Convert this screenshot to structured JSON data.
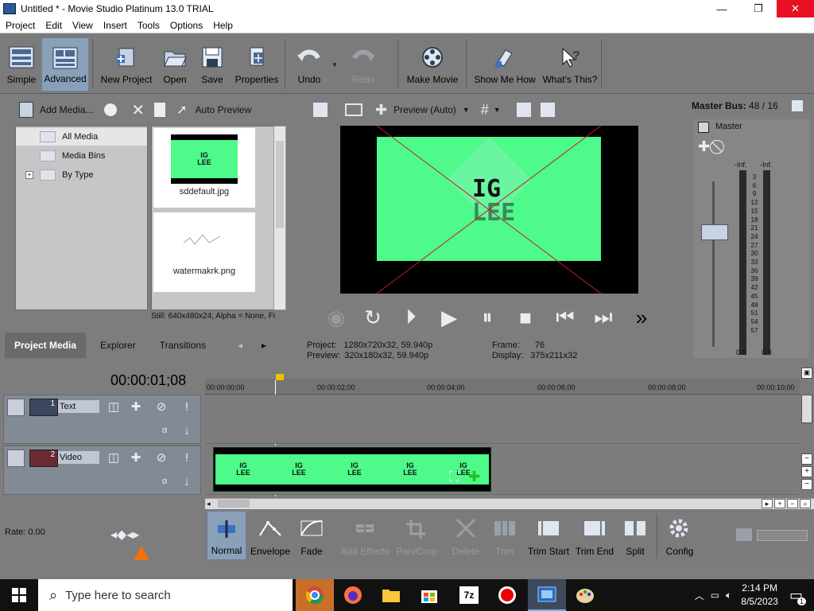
{
  "window": {
    "title": "Untitled * - Movie Studio Platinum 13.0 TRIAL",
    "min": "—",
    "max": "❐",
    "close": "✕"
  },
  "menu": [
    "Project",
    "Edit",
    "View",
    "Insert",
    "Tools",
    "Options",
    "Help"
  ],
  "toolbar": {
    "simple": "Simple",
    "advanced": "Advanced",
    "new_project": "New Project",
    "open": "Open",
    "save": "Save",
    "properties": "Properties",
    "undo": "Undo",
    "redo": "Redo",
    "make_movie": "Make Movie",
    "show_me_how": "Show Me How",
    "whats_this": "What's This?"
  },
  "media": {
    "add_media": "Add Media...",
    "auto_preview": "Auto Preview",
    "tree": [
      "All Media",
      "Media Bins",
      "By Type"
    ],
    "files": [
      "sddefault.jpg",
      "watermakrk.png"
    ],
    "thumb_text": "IG\nLEE",
    "status": "Still: 640x480x24, Alpha = None, Fi",
    "tabs": [
      "Project Media",
      "Explorer",
      "Transitions"
    ]
  },
  "preview": {
    "mode": "Preview (Auto)",
    "screen_text_line1": "IG",
    "screen_text_line2": "LEE",
    "project_label": "Project:",
    "project_value": "1280x720x32, 59.940p",
    "preview_label": "Preview:",
    "preview_value": "320x180x32, 59.940p",
    "frame_label": "Frame:",
    "frame_value": "76",
    "display_label": "Display:",
    "display_value": "375x211x32"
  },
  "mixer": {
    "title": "Master Bus:",
    "value": "48 / 16",
    "master": "Master",
    "inf_left": "-Inf.",
    "inf_right": "-Inf.",
    "scale": [
      "3",
      "6",
      "9",
      "12",
      "15",
      "18",
      "21",
      "24",
      "27",
      "30",
      "33",
      "36",
      "39",
      "42",
      "45",
      "48",
      "51",
      "54",
      "57"
    ],
    "bottom_left": "0.0",
    "bottom_right": "0.0"
  },
  "timeline": {
    "timecode": "00:00:01;08",
    "ticks": [
      "00:00:00;00",
      "00:00:02;00",
      "00:00:04;00",
      "00:00:06;00",
      "00:00:08;00",
      "00:00:10;00"
    ],
    "tracks": [
      {
        "num": "1",
        "name": "Text"
      },
      {
        "num": "2",
        "name": "Video"
      }
    ],
    "clip_frame_text": "IG\nLEE"
  },
  "rate": "Rate: 0.00",
  "edit_tools": {
    "normal": "Normal",
    "envelope": "Envelope",
    "fade": "Fade",
    "add_effects": "Add Effects",
    "pan_crop": "Pan/Crop",
    "delete": "Delete",
    "trim": "Trim",
    "trim_start": "Trim Start",
    "trim_end": "Trim End",
    "split": "Split",
    "config": "Config"
  },
  "taskbar": {
    "search_placeholder": "Type here to search",
    "time": "2:14 PM",
    "date": "8/5/2023",
    "notif": "1"
  },
  "colors": {
    "accent_green": "#4dfa8a",
    "close_red": "#e81123",
    "panel_gray": "#7d7d7d"
  }
}
